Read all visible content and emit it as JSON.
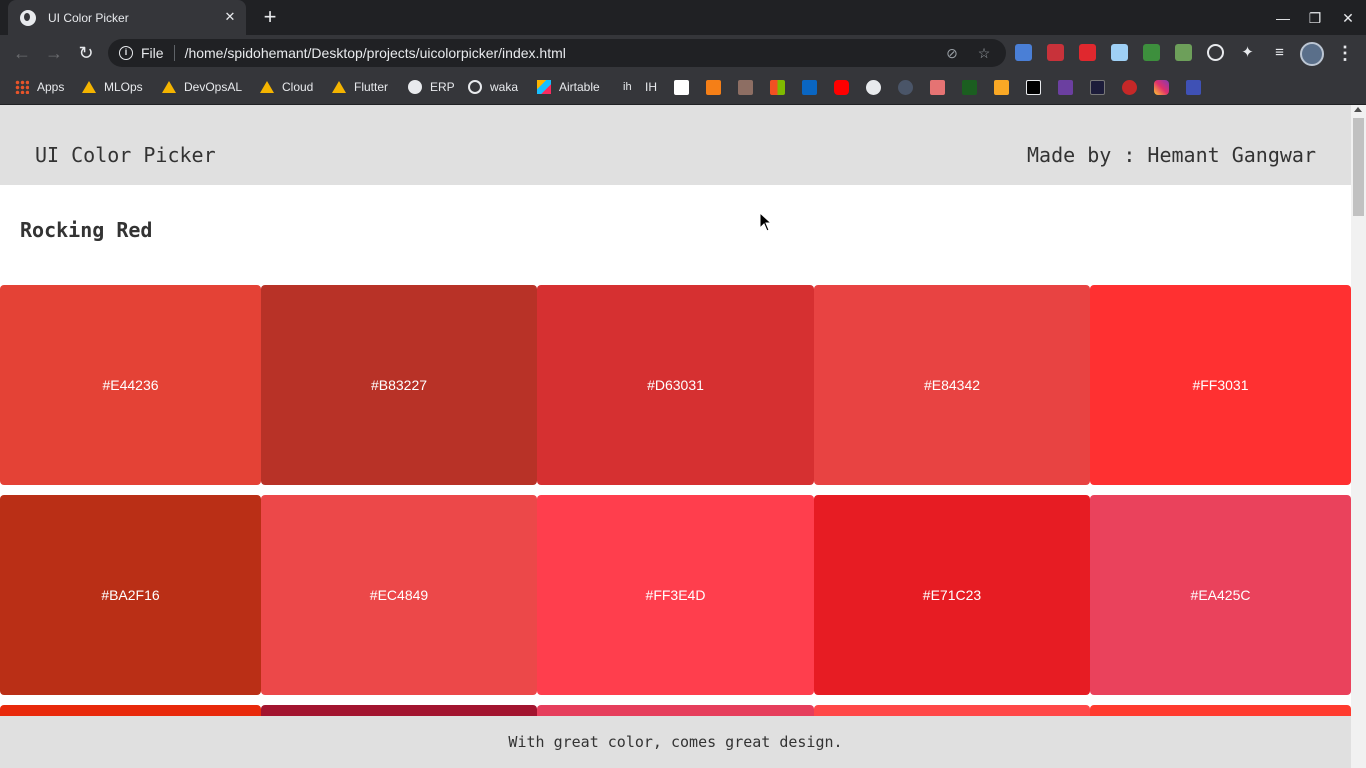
{
  "browser": {
    "tab_title": "UI Color Picker",
    "new_tab": "+",
    "scheme_label": "File",
    "url": "/home/spidohemant/Desktop/projects/uicolorpicker/index.html",
    "bookmarks": [
      {
        "label": "Apps"
      },
      {
        "label": "MLOps"
      },
      {
        "label": "DevOpsAL"
      },
      {
        "label": "Cloud"
      },
      {
        "label": "Flutter"
      },
      {
        "label": "ERP"
      },
      {
        "label": "waka"
      },
      {
        "label": "Airtable"
      },
      {
        "label": "IH"
      }
    ]
  },
  "page": {
    "header_title": "UI Color Picker",
    "header_credit": "Made by : Hemant Gangwar",
    "section_title": "Rocking Red",
    "swatches": [
      {
        "hex": "#E44236",
        "label": "#E44236"
      },
      {
        "hex": "#B83227",
        "label": "#B83227"
      },
      {
        "hex": "#D63031",
        "label": "#D63031"
      },
      {
        "hex": "#E84342",
        "label": "#E84342"
      },
      {
        "hex": "#FF3031",
        "label": "#FF3031"
      },
      {
        "hex": "#BA2F16",
        "label": "#BA2F16"
      },
      {
        "hex": "#EC4849",
        "label": "#EC4849"
      },
      {
        "hex": "#FF3E4D",
        "label": "#FF3E4D"
      },
      {
        "hex": "#E71C23",
        "label": "#E71C23"
      },
      {
        "hex": "#EA425C",
        "label": "#EA425C"
      }
    ],
    "partial_row_colors": [
      "#E8290B",
      "#A2142F",
      "#E63E5C",
      "#FF4848",
      "#FF3B2F"
    ],
    "footer_text": "With great color, comes great design."
  }
}
